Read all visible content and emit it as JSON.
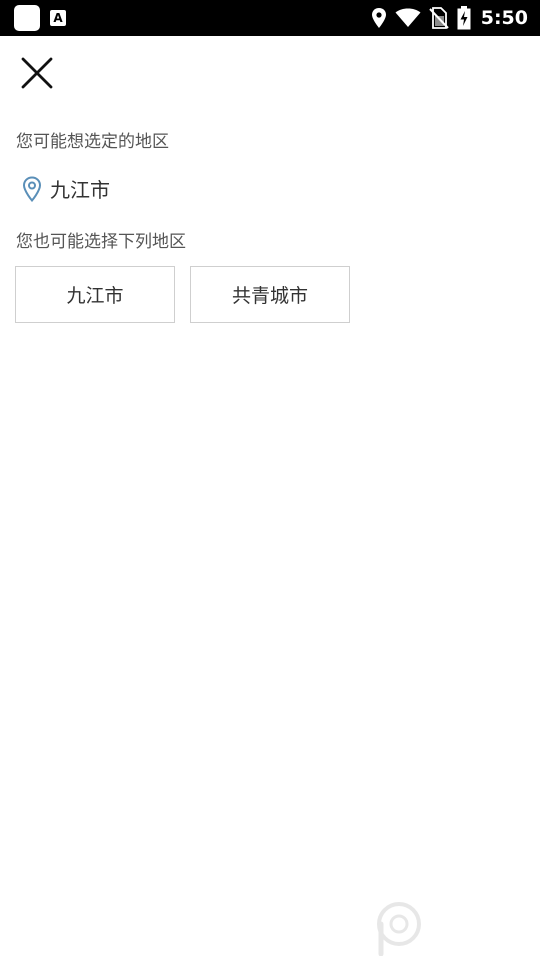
{
  "status_bar": {
    "time": "5:50",
    "font_icon_glyph": "A",
    "icons": [
      "app-icon",
      "font-icon",
      "location-icon",
      "wifi-icon",
      "no-sim-icon",
      "battery-charging-icon"
    ]
  },
  "header": {
    "close_icon": "close-icon"
  },
  "suggested": {
    "title": "您可能想选定的地区",
    "current_location": "九江市"
  },
  "others": {
    "title": "您也可能选择下列地区",
    "regions": [
      {
        "label": "九江市"
      },
      {
        "label": "共青城市"
      }
    ]
  },
  "colors": {
    "accent_icon": "#5a8fb8",
    "text_primary": "#333333",
    "text_secondary": "#555555",
    "border": "#cfcfcf"
  }
}
